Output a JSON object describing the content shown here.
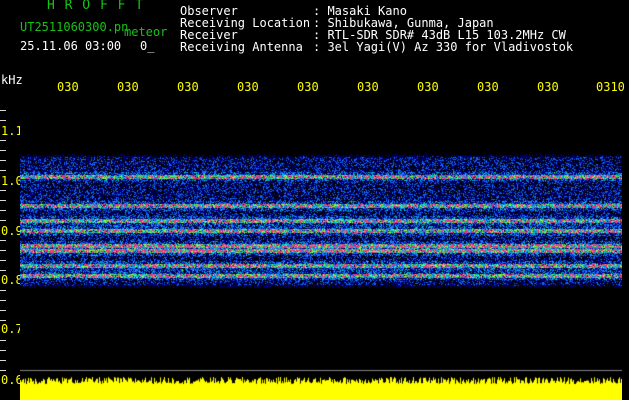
{
  "header": {
    "app_title": "H R O F F T",
    "filename": "UT2511060300.pn",
    "meteor_label": "meteor",
    "datetime": "25.11.06 03:00",
    "count": "0_",
    "info_labels": [
      "Observer",
      "Receiving Location",
      "Receiver",
      "Receiving Antenna"
    ],
    "info_values": [
      ": Masaki Kano",
      ": Shibukawa, Gunma, Japan",
      ": RTL-SDR SDR# 43dB L15 103.2MHz CW",
      ": 3el Yagi(V) Az 330 for Vladivostok"
    ]
  },
  "axis": {
    "unit": "kHz",
    "freq_labels": [
      "1.1",
      "1.0",
      "0.9",
      "0.8",
      "0.7",
      "0.6"
    ],
    "time_labels": [
      "030",
      "030",
      "030",
      "030",
      "030",
      "030",
      "030",
      "030",
      "030",
      "0310"
    ]
  },
  "spectrogram": {
    "bright_bands_khz": [
      1.01,
      0.95,
      0.92,
      0.9,
      0.87,
      0.86,
      0.83,
      0.81
    ],
    "band_range_khz": [
      0.78,
      1.06
    ],
    "colors": {
      "background": "#000000",
      "noise_low": "#000080",
      "noise_mid": "#1565ff",
      "mid": "#00c8c8",
      "high": "#80ff40",
      "peak": "#ff3070",
      "signal_strip": "#ffff00"
    }
  }
}
